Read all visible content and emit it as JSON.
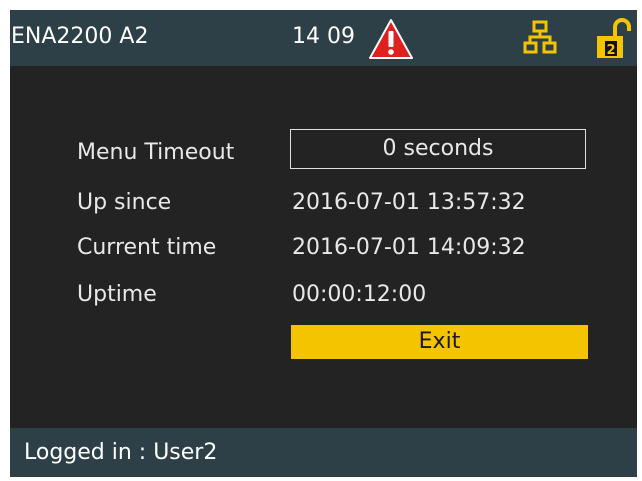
{
  "header": {
    "device_name": "ENA2200 A2",
    "time": "14 09",
    "alarm_icon": "warning-triangle-icon",
    "network_icon": "network-icon",
    "lock_icon": "unlocked-padlock-icon",
    "lock_level": "2",
    "colors": {
      "bar": "#2d4047",
      "accent": "#f5c400",
      "alarm": "#e0201e"
    }
  },
  "info": {
    "menu_timeout_label": "Menu Timeout",
    "menu_timeout_value": "0 seconds",
    "up_since_label": "Up since",
    "up_since_value": "2016-07-01 13:57:32",
    "current_time_label": "Current time",
    "current_time_value": "2016-07-01 14:09:32",
    "uptime_label": "Uptime",
    "uptime_value": "00:00:12:00"
  },
  "actions": {
    "exit_label": "Exit"
  },
  "status": {
    "logged_in": "Logged in : User2"
  }
}
